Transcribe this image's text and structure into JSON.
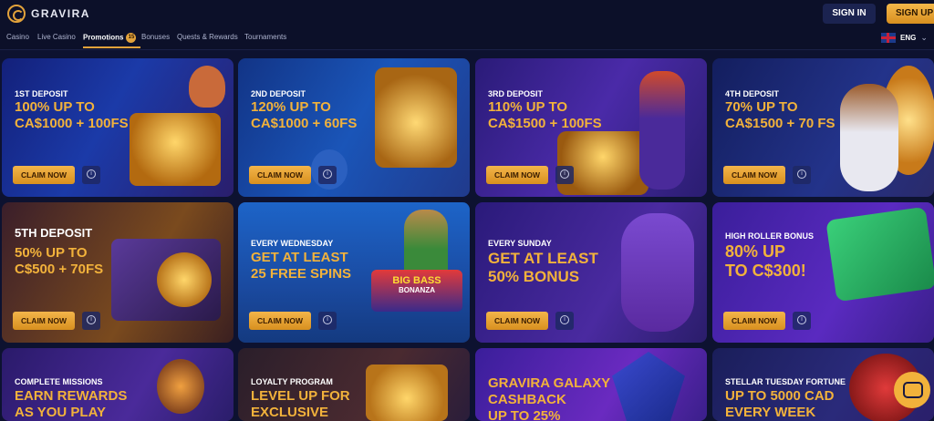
{
  "header": {
    "brand": "GRAVIRA",
    "signin_label": "SIGN IN",
    "signup_label": "SIGN UP"
  },
  "nav": {
    "items": [
      "Casino",
      "Live Casino",
      "Promotions",
      "Bonuses",
      "Quests & Rewards",
      "Tournaments"
    ],
    "promotions_badge": "15",
    "language": "ENG"
  },
  "colors": {
    "accent": "#f2b23b",
    "background": "#0d1230"
  },
  "promos": [
    {
      "sub": "1ST DEPOSIT",
      "title": "100% UP TO\nCA$1000 + 100FS",
      "cta": "CLAIM NOW"
    },
    {
      "sub": "2ND DEPOSIT",
      "title": "120% UP TO\nCA$1000 + 60FS",
      "cta": "CLAIM NOW"
    },
    {
      "sub": "3RD DEPOSIT",
      "title": "110% UP TO\nCA$1500 + 100FS",
      "cta": "CLAIM NOW"
    },
    {
      "sub": "4TH DEPOSIT",
      "title": "70% UP TO\nCA$1500 + 70 FS",
      "cta": "CLAIM NOW"
    },
    {
      "sub": "5TH DEPOSIT",
      "title": "50% UP TO\nC$500 + 70FS",
      "cta": "CLAIM NOW"
    },
    {
      "sub": "EVERY WEDNESDAY",
      "title": "GET AT LEAST\n25 FREE SPINS",
      "cta": "CLAIM NOW",
      "logo_top": "BIG BASS",
      "logo_bottom": "BONANZA"
    },
    {
      "sub": "EVERY SUNDAY",
      "title": "GET AT LEAST\n50% BONUS",
      "cta": "CLAIM NOW"
    },
    {
      "sub": "HIGH ROLLER BONUS",
      "title": "80% UP\nTO C$300!",
      "cta": "CLAIM NOW"
    },
    {
      "sub": "COMPLETE MISSIONS",
      "title": "EARN REWARDS\nAS YOU PLAY"
    },
    {
      "sub": "LOYALTY PROGRAM",
      "title": "LEVEL UP FOR\nEXCLUSIVE"
    },
    {
      "sub": "",
      "title": "GRAVIRA GALAXY\nCASHBACK\nUP TO 25%"
    },
    {
      "sub": "STELLAR TUESDAY FORTUNE",
      "title": "UP TO 5000 CAD\nEVERY WEEK"
    }
  ]
}
